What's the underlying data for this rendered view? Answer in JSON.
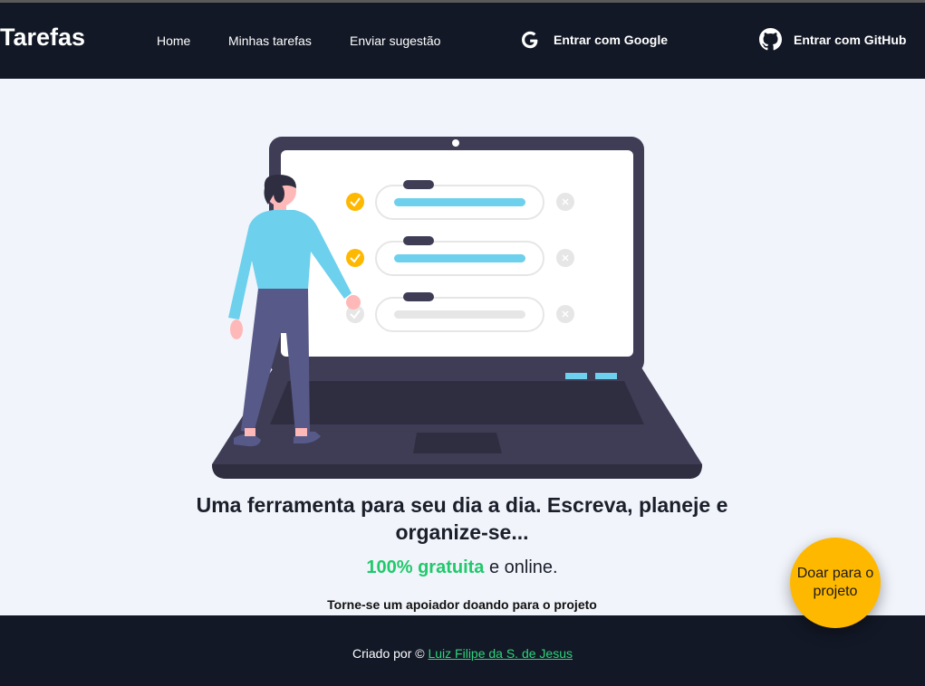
{
  "header": {
    "brand": "Tarefas",
    "nav": [
      {
        "label": "Home"
      },
      {
        "label": "Minhas tarefas"
      },
      {
        "label": "Enviar sugestão"
      }
    ],
    "login_google": "Entrar com Google",
    "login_github": "Entrar com GitHub"
  },
  "hero": {
    "icon": "person-with-laptop-checklist-illustration"
  },
  "main": {
    "headline_line1": "Uma ferramenta para seu dia a dia. Escreva, planeje e",
    "headline_line2": "organize-se...",
    "free_accent": "100% gratuita",
    "free_rest": " e online.",
    "support": "Torne-se um apoiador doando para o projeto"
  },
  "footer": {
    "prefix": "Criado por © ",
    "author": "Luiz Filipe da S. de Jesus"
  },
  "donate_button": {
    "label": "Doar para o projeto"
  },
  "colors": {
    "header_bg": "#121826",
    "page_bg": "#f1f4fb",
    "accent_green": "#20c96b",
    "donate_yellow": "#ffb800"
  }
}
